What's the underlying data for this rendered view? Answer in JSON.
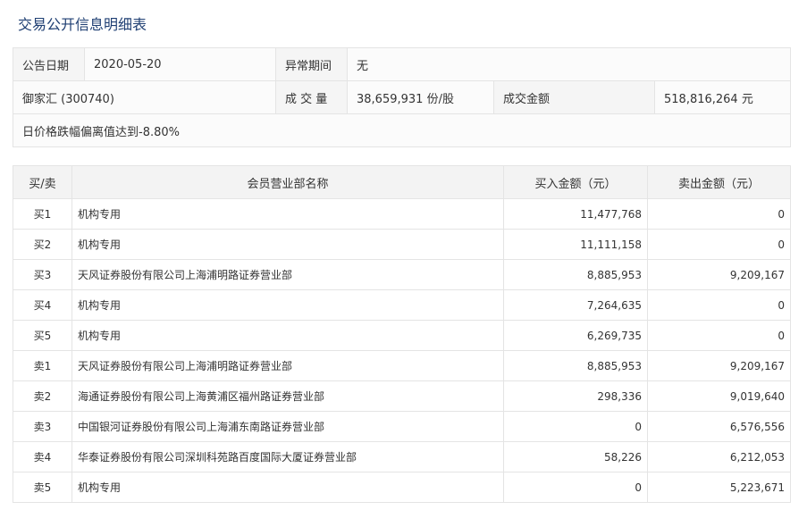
{
  "page_title": "交易公开信息明细表",
  "info": {
    "date_label": "公告日期",
    "date_value": "2020-05-20",
    "abnormal_label": "异常期间",
    "abnormal_value": "无",
    "stock": "御家汇 (300740)",
    "volume_label": "成 交 量",
    "volume_value": "38,659,931 份/股",
    "amount_label": "成交金额",
    "amount_value": "518,816,264 元",
    "reason": "日价格跌幅偏离值达到-8.80%"
  },
  "table": {
    "headers": {
      "side": "买/卖",
      "name": "会员营业部名称",
      "buy": "买入金额（元）",
      "sell": "卖出金额（元）"
    },
    "rows": [
      {
        "side": "买1",
        "name": "机构专用",
        "buy": "11,477,768",
        "sell": "0"
      },
      {
        "side": "买2",
        "name": "机构专用",
        "buy": "11,111,158",
        "sell": "0"
      },
      {
        "side": "买3",
        "name": "天风证券股份有限公司上海浦明路证券营业部",
        "buy": "8,885,953",
        "sell": "9,209,167"
      },
      {
        "side": "买4",
        "name": "机构专用",
        "buy": "7,264,635",
        "sell": "0"
      },
      {
        "side": "买5",
        "name": "机构专用",
        "buy": "6,269,735",
        "sell": "0"
      },
      {
        "side": "卖1",
        "name": "天风证券股份有限公司上海浦明路证券营业部",
        "buy": "8,885,953",
        "sell": "9,209,167"
      },
      {
        "side": "卖2",
        "name": "海通证券股份有限公司上海黄浦区福州路证券营业部",
        "buy": "298,336",
        "sell": "9,019,640"
      },
      {
        "side": "卖3",
        "name": "中国银河证券股份有限公司上海浦东南路证券营业部",
        "buy": "0",
        "sell": "6,576,556"
      },
      {
        "side": "卖4",
        "name": "华泰证券股份有限公司深圳科苑路百度国际大厦证券营业部",
        "buy": "58,226",
        "sell": "6,212,053"
      },
      {
        "side": "卖5",
        "name": "机构专用",
        "buy": "0",
        "sell": "5,223,671"
      }
    ]
  }
}
